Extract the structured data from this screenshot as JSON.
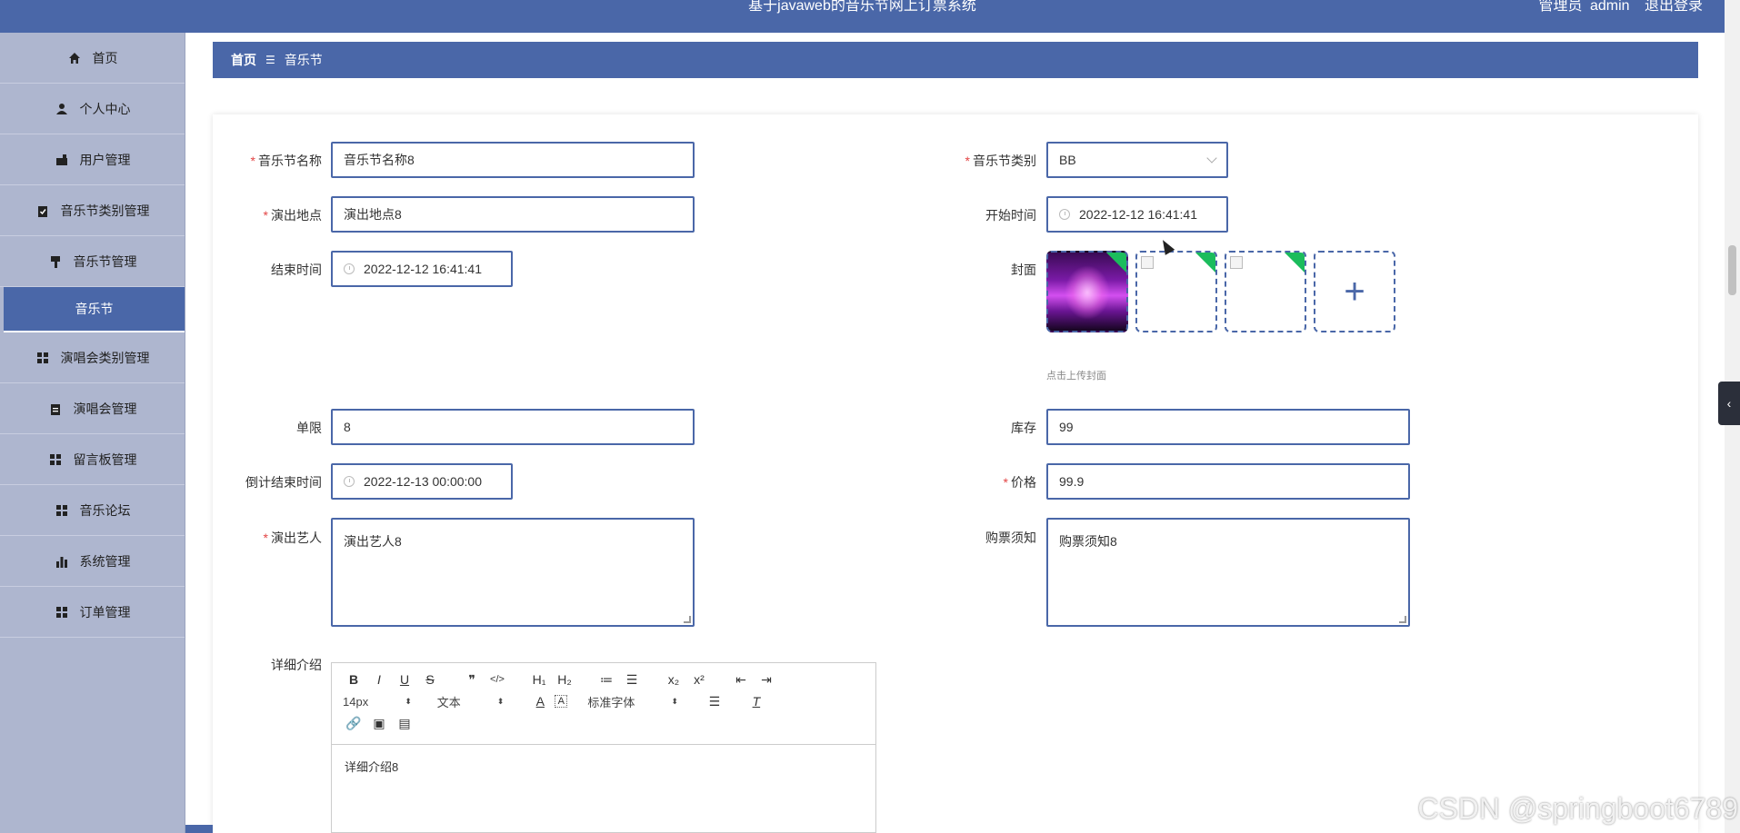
{
  "app": {
    "title": "基于javaweb的音乐节网上订票系统"
  },
  "user": {
    "role": "管理员",
    "name": "admin",
    "logout": "退出登录"
  },
  "sidebar": {
    "items": [
      {
        "label": "首页",
        "icon": "home-icon"
      },
      {
        "label": "个人中心",
        "icon": "user-icon"
      },
      {
        "label": "用户管理",
        "icon": "users-icon"
      },
      {
        "label": "音乐节类别管理",
        "icon": "clipboard-check-icon"
      },
      {
        "label": "音乐节管理",
        "icon": "brush-icon"
      },
      {
        "label": "音乐节",
        "icon": "",
        "active": true
      },
      {
        "label": "演唱会类别管理",
        "icon": "grid-icon"
      },
      {
        "label": "演唱会管理",
        "icon": "clipboard-icon"
      },
      {
        "label": "留言板管理",
        "icon": "grid-icon"
      },
      {
        "label": "音乐论坛",
        "icon": "grid-icon"
      },
      {
        "label": "系统管理",
        "icon": "bar-chart-icon"
      },
      {
        "label": "订单管理",
        "icon": "grid-icon"
      }
    ]
  },
  "breadcrumb": {
    "home": "首页",
    "separator": "☰",
    "current": "音乐节"
  },
  "form": {
    "name": {
      "label": "音乐节名称",
      "value": "音乐节名称8",
      "required": true
    },
    "category": {
      "label": "音乐节类别",
      "value": "BB",
      "required": true
    },
    "venue": {
      "label": "演出地点",
      "value": "演出地点8",
      "required": true
    },
    "start_time": {
      "label": "开始时间",
      "value": "2022-12-12 16:41:41"
    },
    "end_time": {
      "label": "结束时间",
      "value": "2022-12-12 16:41:41"
    },
    "cover": {
      "label": "封面",
      "hint": "点击上传封面",
      "add": "+"
    },
    "limit": {
      "label": "单限",
      "value": "8"
    },
    "stock": {
      "label": "库存",
      "value": "99"
    },
    "countdown": {
      "label": "倒计结束时间",
      "value": "2022-12-13 00:00:00"
    },
    "price": {
      "label": "价格",
      "value": "99.9",
      "required": true
    },
    "artist": {
      "label": "演出艺人",
      "value": "演出艺人8",
      "required": true
    },
    "notice": {
      "label": "购票须知",
      "value": "购票须知8"
    },
    "detail": {
      "label": "详细介绍",
      "value": "详细介绍8"
    }
  },
  "editor": {
    "row1": [
      "B",
      "I",
      "U",
      "S",
      "❞",
      "</>",
      "H₁",
      "H₂",
      "≔",
      "☰",
      "x₂",
      "x²",
      "⇤",
      "⇥"
    ],
    "size": "14px",
    "format": "文本",
    "font": "标准字体",
    "row3": [
      "🔗",
      "▣",
      "▤"
    ]
  },
  "watermark": "CSDN @springboot6789"
}
